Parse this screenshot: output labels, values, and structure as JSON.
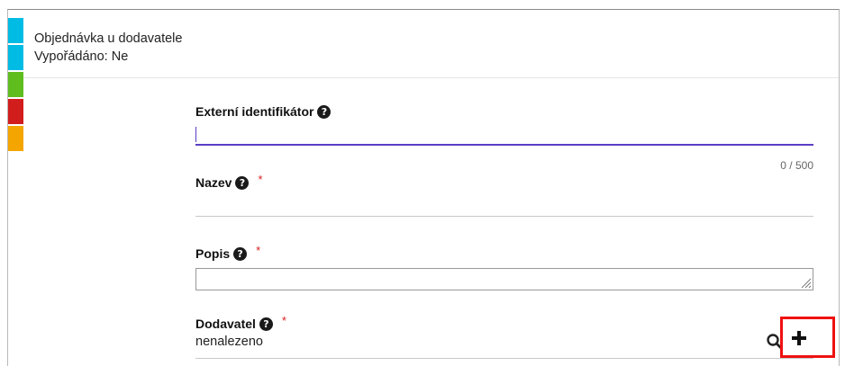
{
  "header": {
    "title": "Objednávka u dodavatele",
    "status": "Vypořádáno: Ne"
  },
  "status_strip": {
    "colors": [
      "#00bce4",
      "#00bce4",
      "#5fbd1e",
      "#d21d1d",
      "#f5a500"
    ]
  },
  "form": {
    "external_id": {
      "label": "Externí identifikátor",
      "value": "",
      "counter": "0 / 500"
    },
    "name": {
      "label": "Nazev",
      "required_mark": "*",
      "value": ""
    },
    "description": {
      "label": "Popis",
      "required_mark": "*",
      "value": ""
    },
    "supplier": {
      "label": "Dodavatel",
      "required_mark": "*",
      "value": "nenalezeno"
    }
  },
  "icons": {
    "help": "question-circle-icon",
    "search": "search-icon",
    "add": "plus-icon"
  },
  "accent_color": "#5b3fc6",
  "highlight_color": "#e11111"
}
